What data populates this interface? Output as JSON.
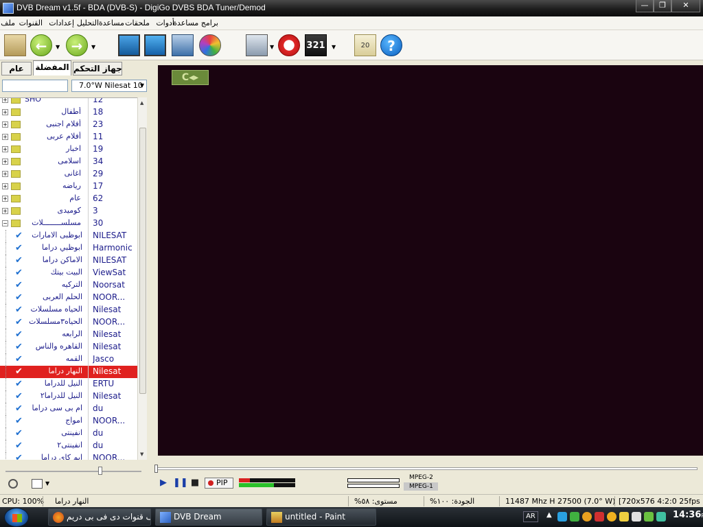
{
  "window": {
    "title": "DVB Dream v1.5f - BDA (DVB-S)  -  DigiGo DVBS BDA Tuner/Demod",
    "min_label": "—",
    "max_label": "❐",
    "close_label": "✕"
  },
  "menu": [
    "ملف",
    "القنوات",
    "إعدادات",
    "التحليل",
    "مساعدة",
    "ملحقات",
    "أدوات",
    "برامج مساعدة"
  ],
  "left_panel": {
    "tabs": [
      "عام",
      "المفضلة",
      "جهاز التحكم"
    ],
    "active_tab": "المفضلة",
    "search_value": "",
    "satellite": "7.0°W Nilesat 10",
    "groups": [
      {
        "name": "SHO",
        "count": "12",
        "rtl": false
      },
      {
        "name": "أطفال",
        "count": "18",
        "rtl": true
      },
      {
        "name": "أفلام اجنبى",
        "count": "23",
        "rtl": true
      },
      {
        "name": "أفلام عربى",
        "count": "11",
        "rtl": true
      },
      {
        "name": "اخبار",
        "count": "19",
        "rtl": true
      },
      {
        "name": "اسلامى",
        "count": "34",
        "rtl": true
      },
      {
        "name": "اغانى",
        "count": "29",
        "rtl": true
      },
      {
        "name": "رياضه",
        "count": "17",
        "rtl": true
      },
      {
        "name": "عام",
        "count": "62",
        "rtl": true
      },
      {
        "name": "كوميدى",
        "count": "3",
        "rtl": true
      },
      {
        "name": "مسلســــــــلات",
        "count": "30",
        "rtl": true
      }
    ],
    "channels": [
      {
        "name": "ابوظبى الامارات",
        "sat": "NILESAT"
      },
      {
        "name": "ابوظبي دراما",
        "sat": "Harmonic"
      },
      {
        "name": "الاماكن دراما",
        "sat": "NILESAT"
      },
      {
        "name": "البيت بيتك",
        "sat": "ViewSat"
      },
      {
        "name": "التركيه",
        "sat": "Noorsat"
      },
      {
        "name": "الحلم العربى",
        "sat": "NOOR..."
      },
      {
        "name": "الحياه مسلسلات",
        "sat": "Nilesat"
      },
      {
        "name": "الحياه٣مسلسلات",
        "sat": "NOOR..."
      },
      {
        "name": "الرابعه",
        "sat": "Nilesat"
      },
      {
        "name": "القاهره والناس",
        "sat": "Nilesat"
      },
      {
        "name": "القمه",
        "sat": "Jasco"
      },
      {
        "name": "النهار دراما",
        "sat": "Nilesat",
        "selected": true
      },
      {
        "name": "النيل للدراما",
        "sat": "ERTU"
      },
      {
        "name": "النيل للدراما٢",
        "sat": "Nilesat"
      },
      {
        "name": "ام بى سى دراما",
        "sat": "du"
      },
      {
        "name": "امواج",
        "sat": "NOOR..."
      },
      {
        "name": "انفينتى",
        "sat": "du"
      },
      {
        "name": "انفينتى٢",
        "sat": "du"
      },
      {
        "name": "ايم كاى دراما",
        "sat": "NOOR..."
      }
    ]
  },
  "video": {
    "badge": "C◂▸"
  },
  "player": {
    "pip_label": "PIP",
    "codec1": "MPEG-2",
    "codec2": "MPEG-1",
    "level_green": 0.62,
    "level_red": 0.2
  },
  "status": {
    "cpu": "CPU: 100%",
    "channel": "النهار دراما",
    "level": "مستوى: ٥٨%",
    "quality": "الجودة: ١٠٠%",
    "tuning": "11487 Mhz  H  27500  (7.0° W)",
    "video_format": "[720x576 4:2:0 25fps"
  },
  "taskbar": {
    "tasks": [
      {
        "label": "ملف قنوات دى فى بى دريم ...",
        "icon": "firefox-icon"
      },
      {
        "label": "DVB Dream",
        "icon": "dvbdream-icon",
        "active": true
      },
      {
        "label": "untitled - Paint",
        "icon": "paint-icon"
      }
    ],
    "language": "AR",
    "clock": "14:36",
    "clock_ampm": "PM"
  },
  "colors": {
    "selection": "#e0211f",
    "video_bg": "#1a0410",
    "list_text": "#1b1b8a",
    "check": "#1e6fd0"
  }
}
